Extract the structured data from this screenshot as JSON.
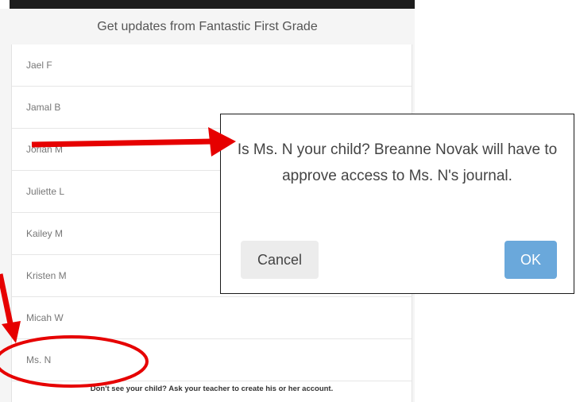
{
  "app": {
    "title": "Get updates from Fantastic First Grade",
    "students": [
      "Jael F",
      "Jamal B",
      "Jorian M",
      "Juliette L",
      "Kailey M",
      "Kristen M",
      "Micah W",
      "Ms. N"
    ],
    "footer": "Don't see your child? Ask your teacher to create his or her account."
  },
  "dialog": {
    "message": "Is Ms. N your child? Breanne Novak will have to approve access to Ms. N's journal.",
    "cancel_label": "Cancel",
    "ok_label": "OK"
  },
  "annotation": {
    "color": "#e60000"
  }
}
